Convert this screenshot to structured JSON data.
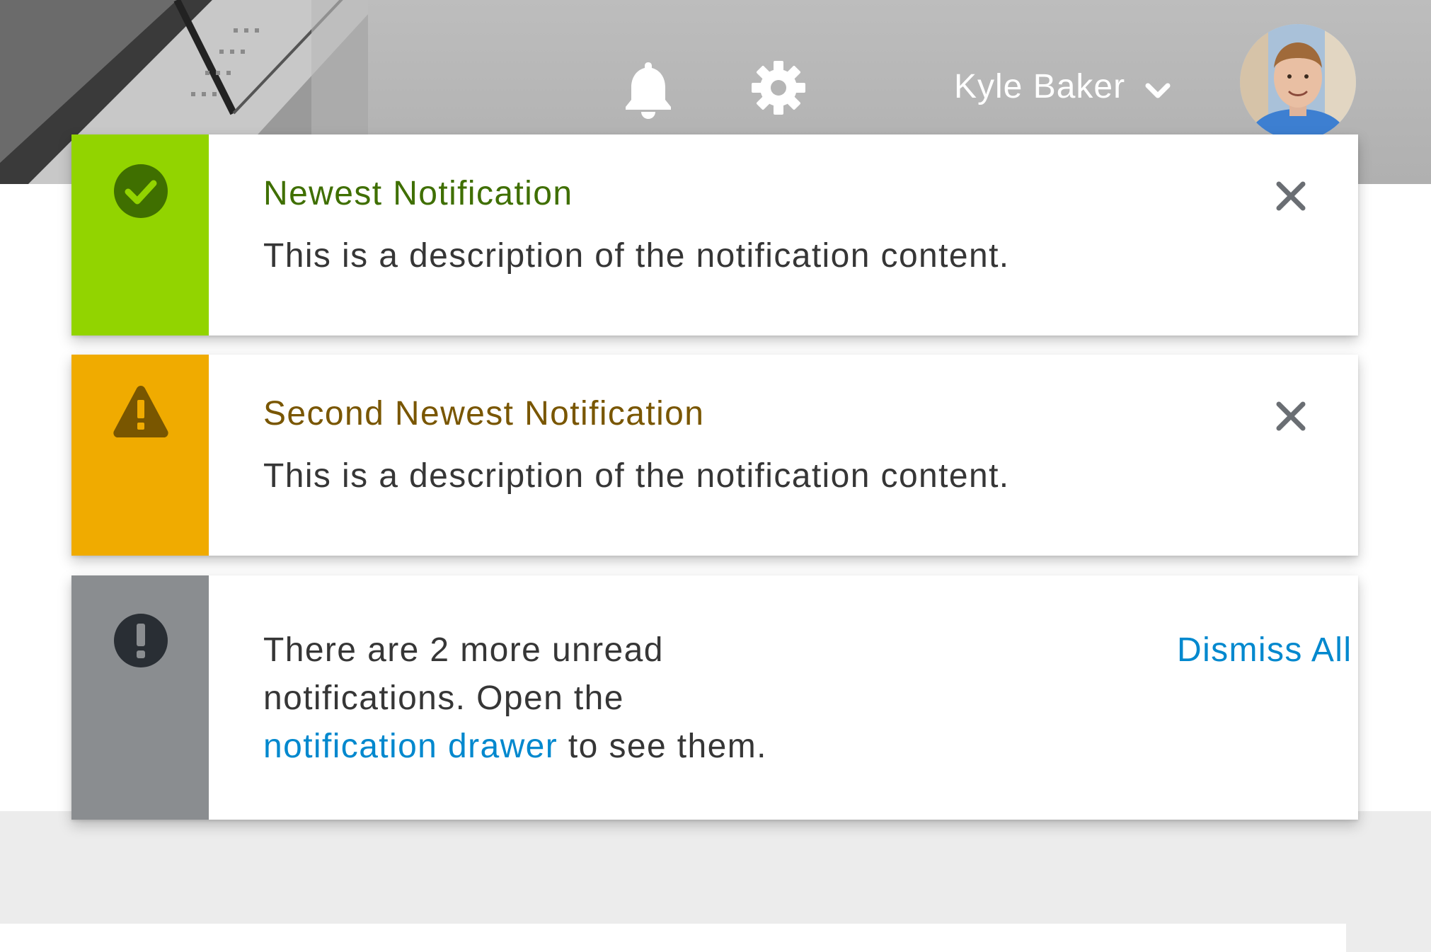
{
  "header": {
    "user_name": "Kyle Baker",
    "icons": [
      "bell-icon",
      "gear-icon",
      "chevron-down-icon"
    ]
  },
  "notifications": [
    {
      "status": "success",
      "status_color": "#92d400",
      "title_color": "#3f6f00",
      "icon": "check-circle-icon",
      "title": "Newest Notification",
      "description": "This is a description of the notification content.",
      "close_icon": "close-icon"
    },
    {
      "status": "warning",
      "status_color": "#f0ab00",
      "title_color": "#795600",
      "icon": "warning-triangle-icon",
      "title": "Second Newest Notification",
      "description": "This is a description of the notification content.",
      "close_icon": "close-icon"
    }
  ],
  "overflow": {
    "status_color": "#8a8d90",
    "icon": "exclamation-circle-icon",
    "line1": "There are 2 more unread",
    "line2": "notifications. Open the",
    "link_text": "notification drawer",
    "suffix": " to see them.",
    "dismiss_label": "Dismiss All",
    "link_color": "#0088ce"
  }
}
